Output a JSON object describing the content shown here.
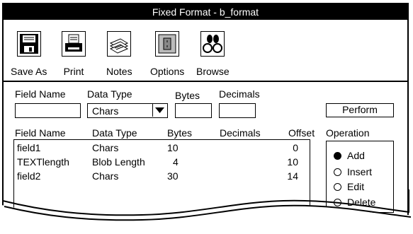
{
  "window": {
    "title": "Fixed Format - b_format"
  },
  "toolbar": {
    "save_as": "Save As",
    "print": "Print",
    "notes": "Notes",
    "options": "Options",
    "browse": "Browse"
  },
  "form": {
    "field_name_label": "Field Name",
    "field_name_value": "",
    "data_type_label": "Data Type",
    "data_type_value": "Chars",
    "bytes_label": "Bytes",
    "bytes_value": "",
    "decimals_label": "Decimals",
    "decimals_value": "",
    "perform_label": "Perform"
  },
  "table": {
    "headers": [
      "Field Name",
      "Data Type",
      "Bytes",
      "Decimals",
      "Offset"
    ],
    "rows": [
      {
        "field_name": "field1",
        "data_type": "Chars",
        "bytes": "10",
        "decimals": "",
        "offset": "0"
      },
      {
        "field_name": "TEXTlength",
        "data_type": "Blob Length",
        "bytes": "4",
        "decimals": "",
        "offset": "10"
      },
      {
        "field_name": "field2",
        "data_type": "Chars",
        "bytes": "30",
        "decimals": "",
        "offset": "14"
      }
    ]
  },
  "operation": {
    "label": "Operation",
    "options": [
      {
        "label": "Add",
        "selected": true
      },
      {
        "label": "Insert",
        "selected": false
      },
      {
        "label": "Edit",
        "selected": false
      },
      {
        "label": "Delete",
        "selected": false
      }
    ]
  }
}
